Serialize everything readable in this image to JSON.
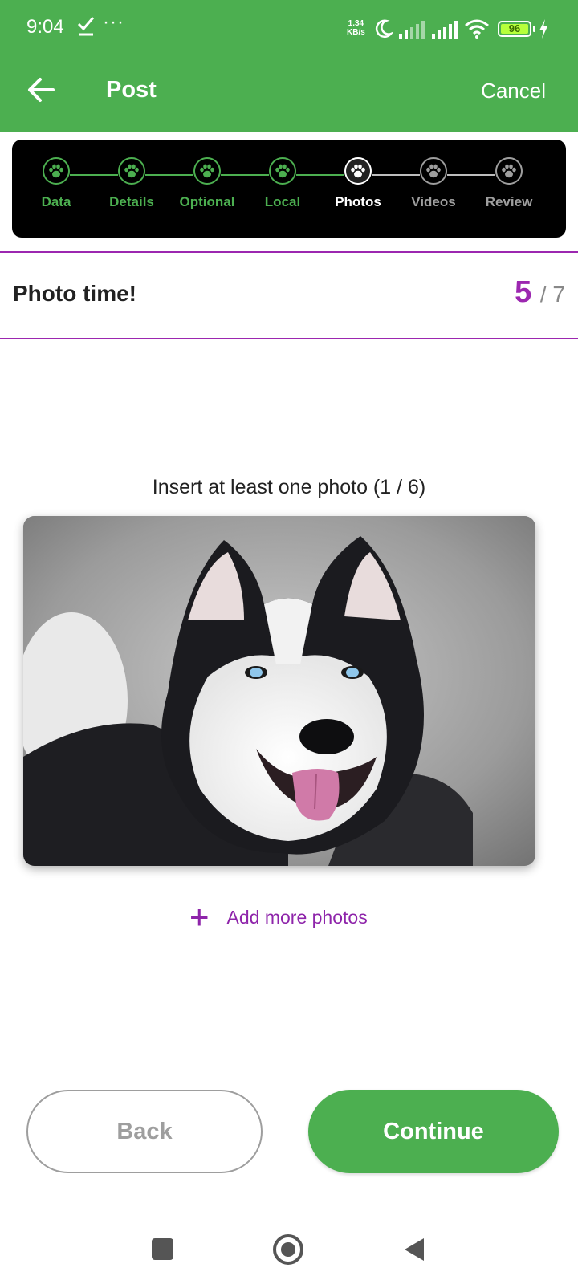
{
  "status_bar": {
    "time": "9:04",
    "speed_value": "1.34",
    "speed_unit": "KB/s",
    "battery": "96"
  },
  "appbar": {
    "title": "Post",
    "cancel_label": "Cancel"
  },
  "stepper": {
    "completed_color": "#4CAF50",
    "current_color": "#ffffff",
    "pending_color": "#9e9e9e",
    "steps": [
      {
        "label": "Data",
        "state": "completed"
      },
      {
        "label": "Details",
        "state": "completed"
      },
      {
        "label": "Optional",
        "state": "completed"
      },
      {
        "label": "Local",
        "state": "completed"
      },
      {
        "label": "Photos",
        "state": "current"
      },
      {
        "label": "Videos",
        "state": "pending"
      },
      {
        "label": "Review",
        "state": "pending"
      }
    ]
  },
  "section": {
    "title": "Photo time!",
    "current_step": "5",
    "total_steps": "/ 7"
  },
  "photos": {
    "instruction": "Insert at least one photo (1 / 6)",
    "add_more_icon": "+",
    "add_more_label": "Add more photos"
  },
  "buttons": {
    "back_label": "Back",
    "continue_label": "Continue"
  },
  "colors": {
    "brand_green": "#4CAF50",
    "accent_purple": "#9c27b0"
  }
}
